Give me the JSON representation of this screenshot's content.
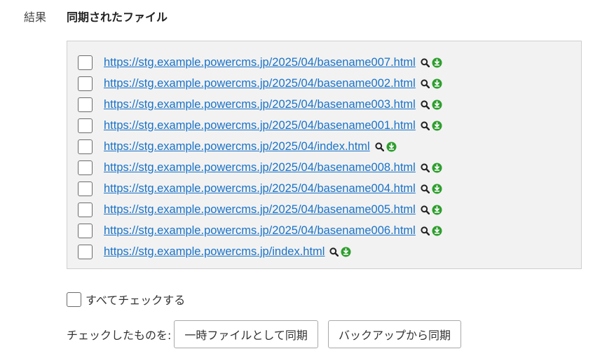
{
  "result_label": "結果",
  "section_title": "同期されたファイル",
  "files": [
    {
      "url": "https://stg.example.powercms.jp/2025/04/basename007.html"
    },
    {
      "url": "https://stg.example.powercms.jp/2025/04/basename002.html"
    },
    {
      "url": "https://stg.example.powercms.jp/2025/04/basename003.html"
    },
    {
      "url": "https://stg.example.powercms.jp/2025/04/basename001.html"
    },
    {
      "url": "https://stg.example.powercms.jp/2025/04/index.html"
    },
    {
      "url": "https://stg.example.powercms.jp/2025/04/basename008.html"
    },
    {
      "url": "https://stg.example.powercms.jp/2025/04/basename004.html"
    },
    {
      "url": "https://stg.example.powercms.jp/2025/04/basename005.html"
    },
    {
      "url": "https://stg.example.powercms.jp/2025/04/basename006.html"
    },
    {
      "url": "https://stg.example.powercms.jp/index.html"
    }
  ],
  "row_icons": [
    "search-icon",
    "download-icon"
  ],
  "check_all_label": "すべてチェックする",
  "actions_label": "チェックしたものを:",
  "buttons": {
    "temp_sync": "一時ファイルとして同期",
    "backup_sync": "バックアップから同期"
  },
  "colors": {
    "link": "#1a73c8",
    "download_icon": "#2e9e2e",
    "box_background": "#f2f2f2"
  }
}
